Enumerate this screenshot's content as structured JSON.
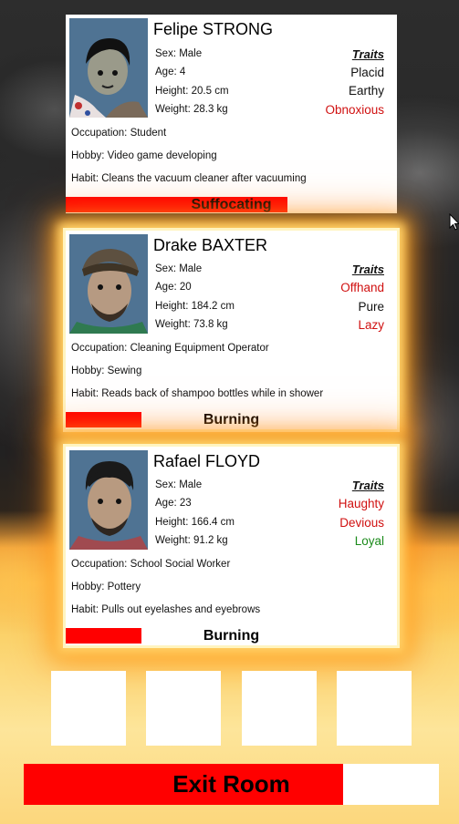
{
  "characters": [
    {
      "name": "Felipe STRONG",
      "sex": "Sex: Male",
      "age": "Age: 4",
      "height": "Height: 20.5 cm",
      "weight": "Weight: 28.3 kg",
      "traits_header": "Traits",
      "traits": [
        {
          "label": "Placid",
          "color": "#111111"
        },
        {
          "label": "Earthy",
          "color": "#111111"
        },
        {
          "label": "Obnoxious",
          "color": "#d01010"
        }
      ],
      "occupation": "Occupation: Student",
      "hobby": "Hobby: Video game developing",
      "habit": "Habit: Cleans the vacuum cleaner after vacuuming",
      "status": "Suffocating",
      "status_level": 0.67
    },
    {
      "name": "Drake BAXTER",
      "sex": "Sex: Male",
      "age": "Age: 20",
      "height": "Height: 184.2 cm",
      "weight": "Weight: 73.8 kg",
      "traits_header": "Traits",
      "traits": [
        {
          "label": "Offhand",
          "color": "#d01010"
        },
        {
          "label": "Pure",
          "color": "#111111"
        },
        {
          "label": "Lazy",
          "color": "#d01010"
        }
      ],
      "occupation": "Occupation: Cleaning Equipment Operator",
      "hobby": "Hobby: Sewing",
      "habit": "Habit: Reads back of shampoo bottles while in shower",
      "status": "Burning",
      "status_level": 0.23
    },
    {
      "name": "Rafael FLOYD",
      "sex": "Sex: Male",
      "age": "Age: 23",
      "height": "Height: 166.4 cm",
      "weight": "Weight: 91.2 kg",
      "traits_header": "Traits",
      "traits": [
        {
          "label": "Haughty",
          "color": "#d01010"
        },
        {
          "label": "Devious",
          "color": "#d01010"
        },
        {
          "label": "Loyal",
          "color": "#1a8a1a"
        }
      ],
      "occupation": "Occupation: School Social Worker",
      "hobby": "Hobby: Pottery",
      "habit": "Habit: Pulls out eyelashes and eyebrows",
      "status": "Burning",
      "status_level": 0.23
    }
  ],
  "exit_button": {
    "label": "Exit Room",
    "progress": 0.77
  },
  "colors": {
    "status_bar": "#ff0000",
    "negative_trait": "#d01010",
    "positive_trait": "#1a8a1a"
  }
}
